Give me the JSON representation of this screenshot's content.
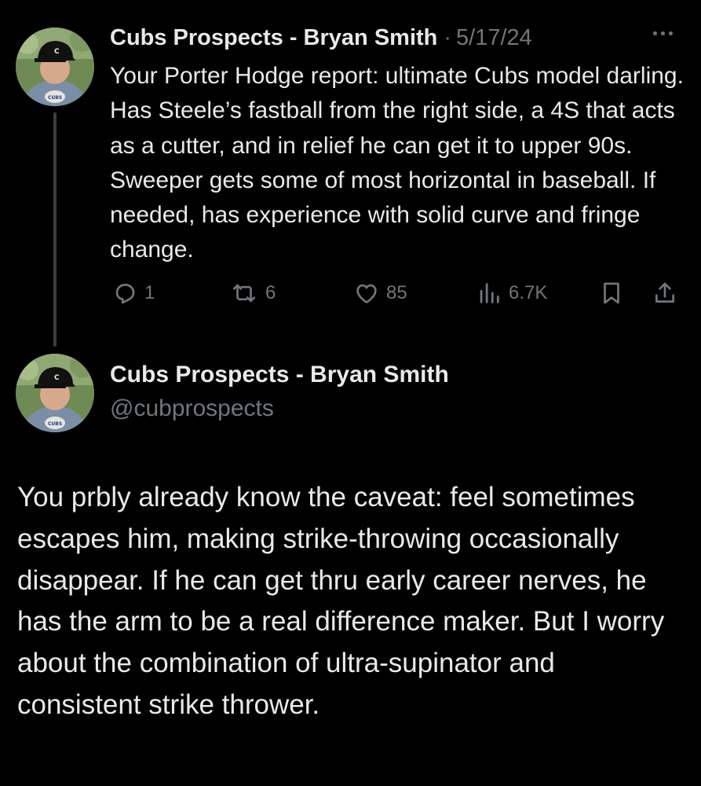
{
  "tweet1": {
    "author_name": "Cubs Prospects - Bryan Smith",
    "separator": "·",
    "date": "5/17/24",
    "text": "Your Porter Hodge report: ultimate Cubs model darling. Has Steele’s fastball from the right side, a 4S that acts as a cutter, and in relief he can get it to upper 90s. Sweeper gets some of most horizontal in baseball. If needed, has experience with solid curve and fringe change.",
    "actions": {
      "replies": "1",
      "reposts": "6",
      "likes": "85",
      "views": "6.7K"
    },
    "icons": {
      "reply": "reply-icon",
      "repost": "repost-icon",
      "like": "heart-icon",
      "views": "views-icon",
      "bookmark": "bookmark-icon",
      "share": "share-icon",
      "more": "more-icon"
    }
  },
  "tweet2": {
    "author_name": "Cubs Prospects - Bryan Smith",
    "handle": "@cubprospects",
    "text": "You prbly already know the caveat: feel sometimes escapes him, making strike-throwing occasionally disappear. If he can get thru early career nerves, he has the arm to be a real difference maker. But I worry about the combination of ultra-supinator and consistent strike thrower."
  },
  "avatar": {
    "cap_logo": "C",
    "shirt_logo": "CUBS"
  },
  "colors": {
    "background": "#000000",
    "text_primary": "#e7e9ea",
    "text_secondary": "#71767b",
    "thread_line": "#3a3d41"
  }
}
